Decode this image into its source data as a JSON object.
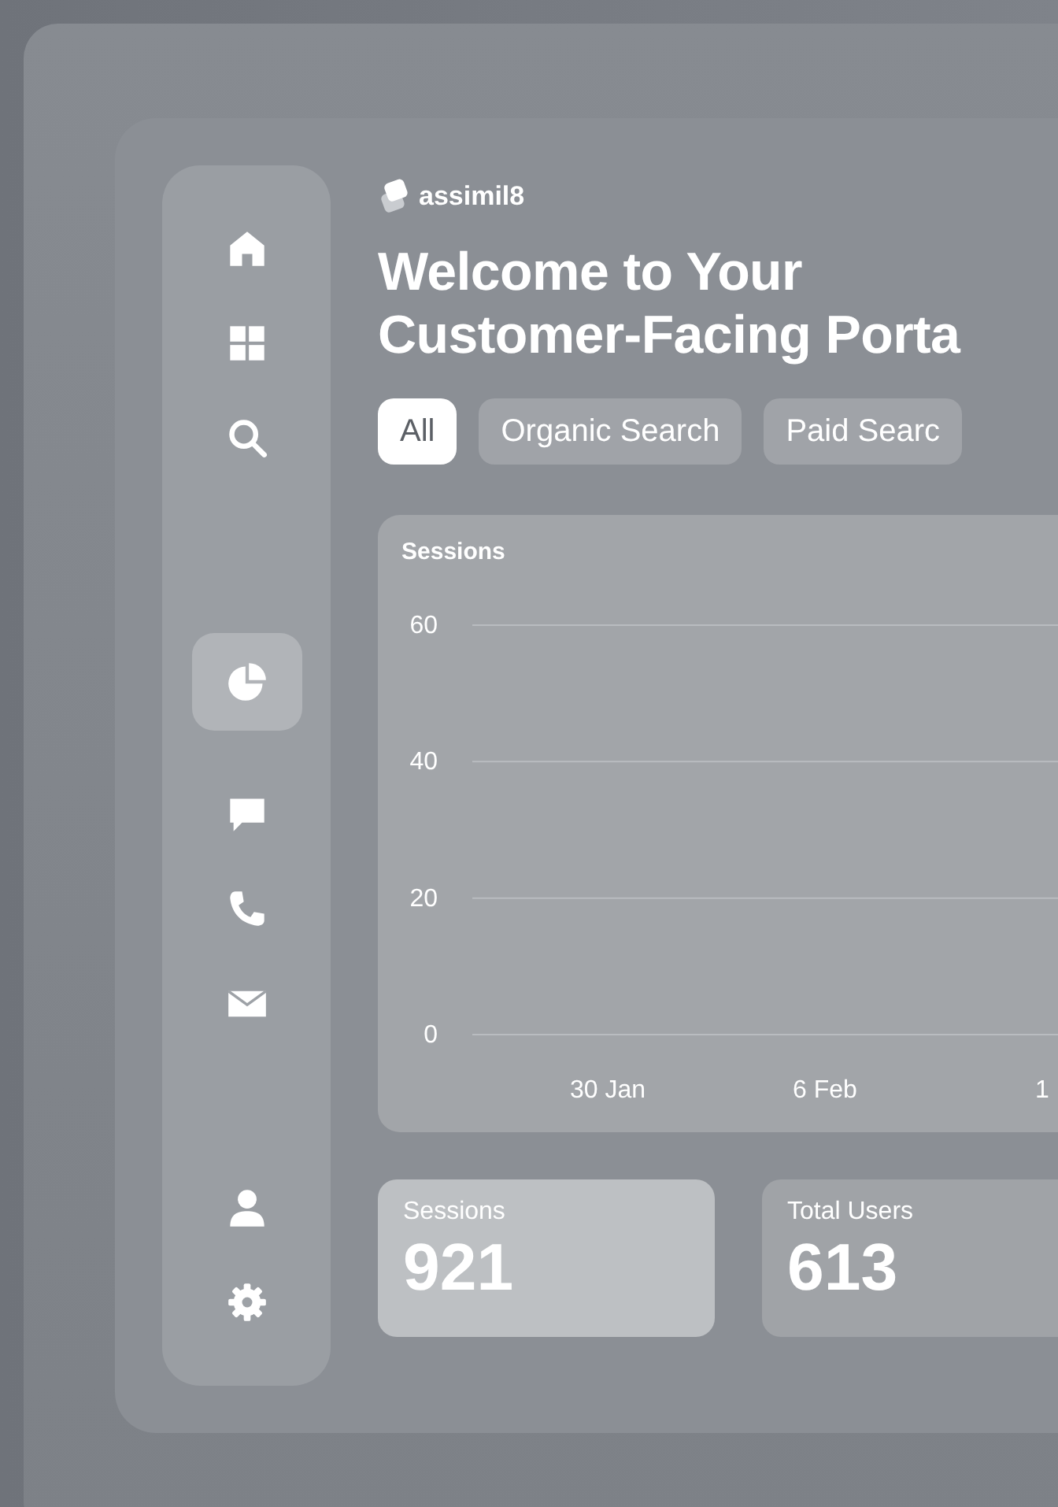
{
  "brand": {
    "name": "assimil8"
  },
  "title": [
    "Welcome to Your",
    "Customer-Facing Porta"
  ],
  "sidebar": {
    "items": [
      {
        "kind": "home",
        "selected": false
      },
      {
        "kind": "grid",
        "selected": false
      },
      {
        "kind": "search",
        "selected": false
      },
      {
        "kind": "pie",
        "selected": true
      },
      {
        "kind": "chat",
        "selected": false
      },
      {
        "kind": "phone",
        "selected": false
      },
      {
        "kind": "mail",
        "selected": false
      },
      {
        "kind": "user",
        "selected": false
      },
      {
        "kind": "gear",
        "selected": false
      }
    ]
  },
  "filters": [
    {
      "label": "All",
      "selected": true
    },
    {
      "label": "Organic Search",
      "selected": false
    },
    {
      "label": "Paid Searc",
      "selected": false
    }
  ],
  "chart": {
    "chart_data": {
      "type": "line",
      "title": "Sessions",
      "ylim": [
        0,
        60
      ],
      "yticks": [
        {
          "value": 0,
          "label": "0"
        },
        {
          "value": 20,
          "label": "20"
        },
        {
          "value": 40,
          "label": "40"
        },
        {
          "value": 60,
          "label": "60"
        }
      ],
      "categories": [
        "30 Jan",
        "6 Feb",
        "1"
      ]
    }
  },
  "stats": [
    {
      "label": "Sessions",
      "value": "921",
      "selected": true
    },
    {
      "label": "Total Users",
      "value": "613",
      "selected": false
    }
  ]
}
